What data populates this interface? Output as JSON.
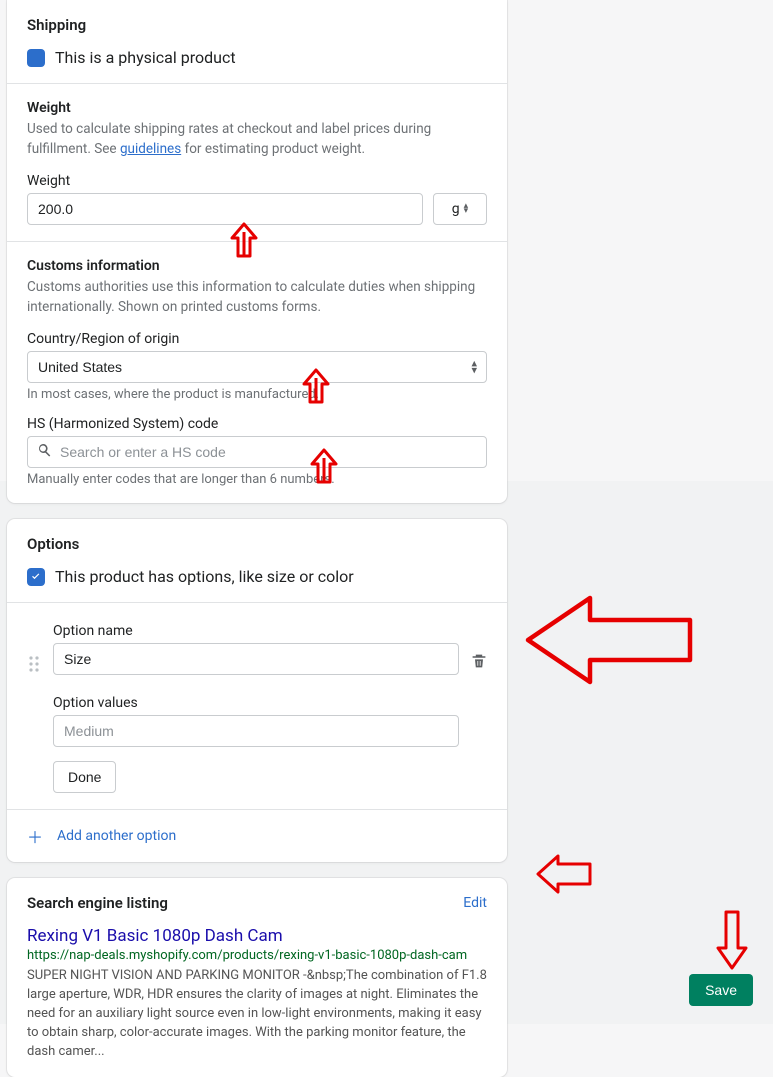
{
  "shipping": {
    "title": "Shipping",
    "physical_product_label": "This is a physical product",
    "weight_section_title": "Weight",
    "weight_desc_before": "Used to calculate shipping rates at checkout and label prices during fulfillment. See ",
    "weight_desc_link": "guidelines",
    "weight_desc_after": " for estimating product weight.",
    "weight_label": "Weight",
    "weight_value": "200.0",
    "weight_unit": "g",
    "customs_title": "Customs information",
    "customs_desc": "Customs authorities use this information to calculate duties when shipping internationally. Shown on printed customs forms.",
    "country_label": "Country/Region of origin",
    "country_value": "United States",
    "country_help": "In most cases, where the product is manufactured.",
    "hs_label": "HS (Harmonized System) code",
    "hs_placeholder": "Search or enter a HS code",
    "hs_help": "Manually enter codes that are longer than 6 numbers."
  },
  "options": {
    "title": "Options",
    "has_options_label": "This product has options, like size or color",
    "option_name_label": "Option name",
    "option_name_value": "Size",
    "option_values_label": "Option values",
    "option_values_placeholder": "Medium",
    "done_label": "Done",
    "add_another_label": "Add another option"
  },
  "seo": {
    "title": "Search engine listing",
    "edit_label": "Edit",
    "preview_title": "Rexing V1 Basic 1080p Dash Cam",
    "preview_url": "https://nap-deals.myshopify.com/products/rexing-v1-basic-1080p-dash-cam",
    "preview_desc": "SUPER NIGHT VISION AND PARKING MONITOR -&nbsp;The combination of F1.8 large aperture, WDR, HDR ensures the clarity of images at night. Eliminates the need for an auxiliary light source even in low-light environments, making it easy to obtain sharp, color-accurate images. With the parking monitor feature, the dash camer..."
  },
  "save_label": "Save"
}
